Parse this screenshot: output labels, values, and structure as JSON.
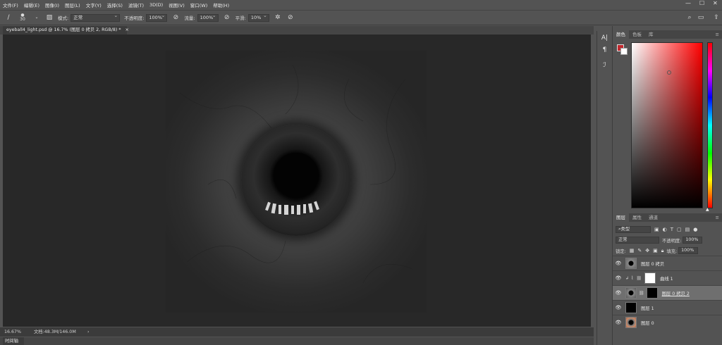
{
  "menu": {
    "items": [
      "文件(F)",
      "编辑(E)",
      "图像(I)",
      "图层(L)",
      "文字(Y)",
      "选择(S)",
      "滤镜(T)",
      "3D(D)",
      "视图(V)",
      "窗口(W)",
      "帮助(H)"
    ],
    "window_controls": [
      "—",
      "☐",
      "✕"
    ]
  },
  "options": {
    "brush_size": "30",
    "mode_label": "模式:",
    "mode_value": "正常",
    "opacity_label": "不透明度:",
    "opacity_value": "100%",
    "flow_label": "流量:",
    "flow_value": "100%",
    "smooth_label": "平滑:",
    "smooth_value": "10%"
  },
  "document": {
    "tab_title": "eyeball4_light.psd @ 16.7% (图层 0 拷贝 2, RGB/8) *"
  },
  "status": {
    "zoom": "16.67%",
    "doc_info": "文档:48.3M/146.0M",
    "arrow": "›"
  },
  "timeline": {
    "label": "时间轴"
  },
  "color_panel": {
    "tabs": [
      "颜色",
      "色板",
      "库"
    ],
    "foreground": "#c1272d",
    "background": "#ffffff"
  },
  "layers_panel": {
    "tabs": [
      "图层",
      "属性",
      "通道"
    ],
    "filter_value": "类型",
    "blend_mode": "正常",
    "opacity_label": "不透明度:",
    "opacity_value": "100%",
    "lock_label": "锁定:",
    "fill_label": "填充:",
    "fill_value": "100%",
    "layers": [
      {
        "name": "图层 0 拷贝",
        "selected": false
      },
      {
        "name": "曲线 1",
        "selected": false
      },
      {
        "name": "图层 0 拷贝 2",
        "selected": true
      },
      {
        "name": "图层 1",
        "selected": false
      },
      {
        "name": "图层 0",
        "selected": false
      }
    ]
  }
}
